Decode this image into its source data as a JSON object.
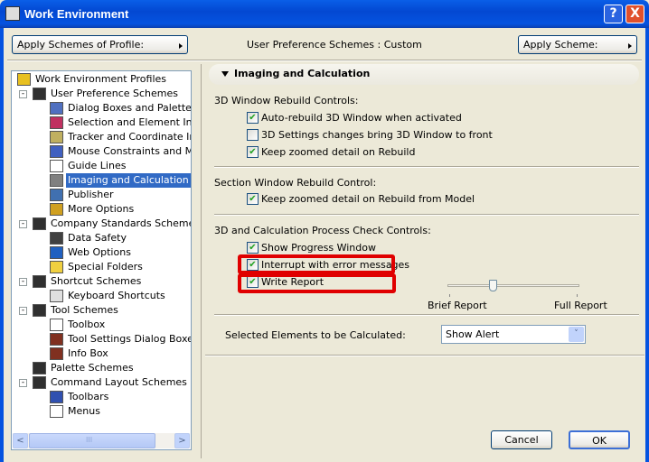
{
  "window": {
    "title": "Work Environment",
    "help_label": "?",
    "close_label": "X"
  },
  "toolbar": {
    "apply_profile_label": "Apply Schemes of Profile:",
    "scheme_status": "User Preference Schemes : Custom",
    "apply_scheme_label": "Apply Scheme:"
  },
  "tree": {
    "scroll_left": "<",
    "scroll_right": ">",
    "scroll_grip": "III",
    "items": [
      {
        "label": "Work Environment Profiles",
        "level": 0,
        "icon": "profiles-icon",
        "color": "#e8c020",
        "expander": ""
      },
      {
        "label": "User Preference Schemes",
        "level": 1,
        "icon": "floppy-disk-icon",
        "color": "#303030",
        "expander": "-"
      },
      {
        "label": "Dialog Boxes and Palettes",
        "level": 2,
        "icon": "windows-icon",
        "color": "#5070c0",
        "expander": ""
      },
      {
        "label": "Selection and Element Inform",
        "level": 2,
        "icon": "selection-icon",
        "color": "#c03060",
        "expander": ""
      },
      {
        "label": "Tracker and Coordinate Input",
        "level": 2,
        "icon": "tracker-icon",
        "color": "#c0b060",
        "expander": ""
      },
      {
        "label": "Mouse Constraints and Meth",
        "level": 2,
        "icon": "mouse-icon",
        "color": "#4060c0",
        "expander": ""
      },
      {
        "label": "Guide Lines",
        "level": 2,
        "icon": "guide-lines-icon",
        "color": "#ffffff",
        "expander": ""
      },
      {
        "label": "Imaging and Calculation",
        "level": 2,
        "icon": "imaging-icon",
        "color": "#808080",
        "expander": "",
        "selected": true
      },
      {
        "label": "Publisher",
        "level": 2,
        "icon": "publisher-icon",
        "color": "#4070b0",
        "expander": ""
      },
      {
        "label": "More Options",
        "level": 2,
        "icon": "sliders-icon",
        "color": "#d0a020",
        "expander": ""
      },
      {
        "label": "Company Standards Schemes",
        "level": 1,
        "icon": "floppy-disk-icon",
        "color": "#303030",
        "expander": "-"
      },
      {
        "label": "Data Safety",
        "level": 2,
        "icon": "clock-disk-icon",
        "color": "#404040",
        "expander": ""
      },
      {
        "label": "Web Options",
        "level": 2,
        "icon": "globe-icon",
        "color": "#2060c0",
        "expander": ""
      },
      {
        "label": "Special Folders",
        "level": 2,
        "icon": "folder-icon",
        "color": "#f0d040",
        "expander": ""
      },
      {
        "label": "Shortcut Schemes",
        "level": 1,
        "icon": "floppy-disk-icon",
        "color": "#303030",
        "expander": "-"
      },
      {
        "label": "Keyboard Shortcuts",
        "level": 2,
        "icon": "shortcut-icon",
        "color": "#e0e0e0",
        "expander": ""
      },
      {
        "label": "Tool Schemes",
        "level": 1,
        "icon": "hammer-disk-icon",
        "color": "#303030",
        "expander": "-"
      },
      {
        "label": "Toolbox",
        "level": 2,
        "icon": "toolbox-grid-icon",
        "color": "#ffffff",
        "expander": ""
      },
      {
        "label": "Tool Settings Dialog Boxes",
        "level": 2,
        "icon": "hammer-icon",
        "color": "#803020",
        "expander": ""
      },
      {
        "label": "Info Box",
        "level": 2,
        "icon": "info-hammer-icon",
        "color": "#803020",
        "expander": ""
      },
      {
        "label": "Palette Schemes",
        "level": 1,
        "icon": "floppy-disk-icon",
        "color": "#303030",
        "expander": ""
      },
      {
        "label": "Command Layout Schemes",
        "level": 1,
        "icon": "floppy-disk-icon",
        "color": "#303030",
        "expander": "-"
      },
      {
        "label": "Toolbars",
        "level": 2,
        "icon": "toolbar-icon",
        "color": "#3050b0",
        "expander": ""
      },
      {
        "label": "Menus",
        "level": 2,
        "icon": "menu-icon",
        "color": "#ffffff",
        "expander": ""
      }
    ]
  },
  "panel": {
    "header": "Imaging and Calculation",
    "section1": {
      "title": "3D Window Rebuild Controls:",
      "options": [
        {
          "label": "Auto-rebuild 3D Window when activated",
          "checked": true
        },
        {
          "label": "3D Settings changes bring 3D Window to front",
          "checked": false
        },
        {
          "label": "Keep zoomed detail on Rebuild",
          "checked": true
        }
      ]
    },
    "section2": {
      "title": "Section Window Rebuild Control:",
      "options": [
        {
          "label": "Keep zoomed detail on Rebuild from Model",
          "checked": true
        }
      ]
    },
    "section3": {
      "title": "3D and Calculation Process Check Controls:",
      "options": [
        {
          "label": "Show Progress Window",
          "checked": true
        },
        {
          "label": "Interrupt with error messages",
          "checked": true
        },
        {
          "label": "Write Report",
          "checked": true
        }
      ]
    },
    "report_slider": {
      "value": 0.34,
      "min_label": "Brief Report",
      "max_label": "Full Report"
    },
    "calc_label": "Selected Elements to be Calculated:",
    "calc_select": "Show Alert",
    "dropdown_glyph": "˅",
    "check_glyph": "✔",
    "highlight_color": "#e00000"
  },
  "footer": {
    "cancel_label": "Cancel",
    "ok_label": "OK"
  }
}
